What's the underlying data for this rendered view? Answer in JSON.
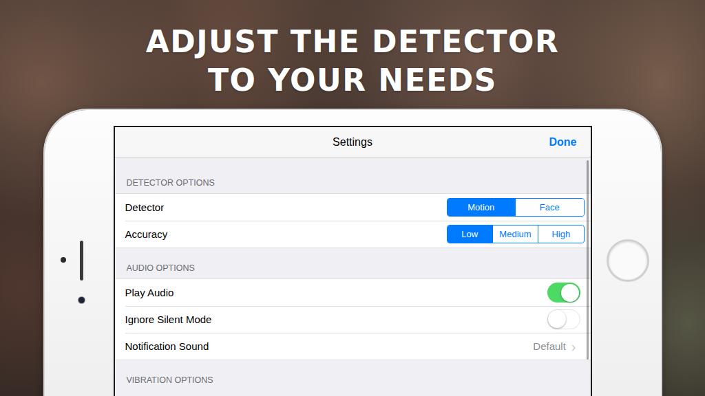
{
  "headline": [
    "ADJUST THE DETECTOR",
    "TO YOUR NEEDS"
  ],
  "nav": {
    "title": "Settings",
    "done": "Done"
  },
  "sections": [
    {
      "header": "DETECTOR OPTIONS",
      "rows": [
        {
          "kind": "segmented",
          "label": "Detector",
          "options": [
            {
              "label": "Motion",
              "selected": true
            },
            {
              "label": "Face",
              "selected": false
            }
          ]
        },
        {
          "kind": "segmented",
          "label": "Accuracy",
          "options": [
            {
              "label": "Low",
              "selected": true
            },
            {
              "label": "Medium",
              "selected": false
            },
            {
              "label": "High",
              "selected": false
            }
          ]
        }
      ]
    },
    {
      "header": "AUDIO OPTIONS",
      "rows": [
        {
          "kind": "toggle",
          "label": "Play Audio",
          "on": true
        },
        {
          "kind": "toggle",
          "label": "Ignore Silent Mode",
          "on": false
        },
        {
          "kind": "disclosure",
          "label": "Notification Sound",
          "value": "Default",
          "chevron": "›"
        }
      ]
    },
    {
      "header": "VIBRATION OPTIONS",
      "rows": []
    }
  ]
}
